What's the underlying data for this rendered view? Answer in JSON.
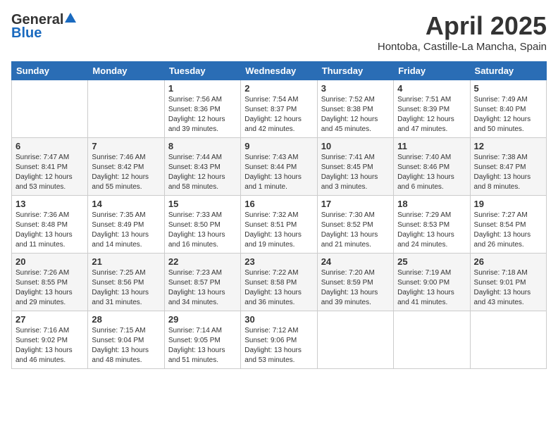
{
  "logo": {
    "general": "General",
    "blue": "Blue"
  },
  "header": {
    "month": "April 2025",
    "location": "Hontoba, Castille-La Mancha, Spain"
  },
  "weekdays": [
    "Sunday",
    "Monday",
    "Tuesday",
    "Wednesday",
    "Thursday",
    "Friday",
    "Saturday"
  ],
  "weeks": [
    [
      {
        "day": "",
        "sunrise": "",
        "sunset": "",
        "daylight": ""
      },
      {
        "day": "",
        "sunrise": "",
        "sunset": "",
        "daylight": ""
      },
      {
        "day": "1",
        "sunrise": "Sunrise: 7:56 AM",
        "sunset": "Sunset: 8:36 PM",
        "daylight": "Daylight: 12 hours and 39 minutes."
      },
      {
        "day": "2",
        "sunrise": "Sunrise: 7:54 AM",
        "sunset": "Sunset: 8:37 PM",
        "daylight": "Daylight: 12 hours and 42 minutes."
      },
      {
        "day": "3",
        "sunrise": "Sunrise: 7:52 AM",
        "sunset": "Sunset: 8:38 PM",
        "daylight": "Daylight: 12 hours and 45 minutes."
      },
      {
        "day": "4",
        "sunrise": "Sunrise: 7:51 AM",
        "sunset": "Sunset: 8:39 PM",
        "daylight": "Daylight: 12 hours and 47 minutes."
      },
      {
        "day": "5",
        "sunrise": "Sunrise: 7:49 AM",
        "sunset": "Sunset: 8:40 PM",
        "daylight": "Daylight: 12 hours and 50 minutes."
      }
    ],
    [
      {
        "day": "6",
        "sunrise": "Sunrise: 7:47 AM",
        "sunset": "Sunset: 8:41 PM",
        "daylight": "Daylight: 12 hours and 53 minutes."
      },
      {
        "day": "7",
        "sunrise": "Sunrise: 7:46 AM",
        "sunset": "Sunset: 8:42 PM",
        "daylight": "Daylight: 12 hours and 55 minutes."
      },
      {
        "day": "8",
        "sunrise": "Sunrise: 7:44 AM",
        "sunset": "Sunset: 8:43 PM",
        "daylight": "Daylight: 12 hours and 58 minutes."
      },
      {
        "day": "9",
        "sunrise": "Sunrise: 7:43 AM",
        "sunset": "Sunset: 8:44 PM",
        "daylight": "Daylight: 13 hours and 1 minute."
      },
      {
        "day": "10",
        "sunrise": "Sunrise: 7:41 AM",
        "sunset": "Sunset: 8:45 PM",
        "daylight": "Daylight: 13 hours and 3 minutes."
      },
      {
        "day": "11",
        "sunrise": "Sunrise: 7:40 AM",
        "sunset": "Sunset: 8:46 PM",
        "daylight": "Daylight: 13 hours and 6 minutes."
      },
      {
        "day": "12",
        "sunrise": "Sunrise: 7:38 AM",
        "sunset": "Sunset: 8:47 PM",
        "daylight": "Daylight: 13 hours and 8 minutes."
      }
    ],
    [
      {
        "day": "13",
        "sunrise": "Sunrise: 7:36 AM",
        "sunset": "Sunset: 8:48 PM",
        "daylight": "Daylight: 13 hours and 11 minutes."
      },
      {
        "day": "14",
        "sunrise": "Sunrise: 7:35 AM",
        "sunset": "Sunset: 8:49 PM",
        "daylight": "Daylight: 13 hours and 14 minutes."
      },
      {
        "day": "15",
        "sunrise": "Sunrise: 7:33 AM",
        "sunset": "Sunset: 8:50 PM",
        "daylight": "Daylight: 13 hours and 16 minutes."
      },
      {
        "day": "16",
        "sunrise": "Sunrise: 7:32 AM",
        "sunset": "Sunset: 8:51 PM",
        "daylight": "Daylight: 13 hours and 19 minutes."
      },
      {
        "day": "17",
        "sunrise": "Sunrise: 7:30 AM",
        "sunset": "Sunset: 8:52 PM",
        "daylight": "Daylight: 13 hours and 21 minutes."
      },
      {
        "day": "18",
        "sunrise": "Sunrise: 7:29 AM",
        "sunset": "Sunset: 8:53 PM",
        "daylight": "Daylight: 13 hours and 24 minutes."
      },
      {
        "day": "19",
        "sunrise": "Sunrise: 7:27 AM",
        "sunset": "Sunset: 8:54 PM",
        "daylight": "Daylight: 13 hours and 26 minutes."
      }
    ],
    [
      {
        "day": "20",
        "sunrise": "Sunrise: 7:26 AM",
        "sunset": "Sunset: 8:55 PM",
        "daylight": "Daylight: 13 hours and 29 minutes."
      },
      {
        "day": "21",
        "sunrise": "Sunrise: 7:25 AM",
        "sunset": "Sunset: 8:56 PM",
        "daylight": "Daylight: 13 hours and 31 minutes."
      },
      {
        "day": "22",
        "sunrise": "Sunrise: 7:23 AM",
        "sunset": "Sunset: 8:57 PM",
        "daylight": "Daylight: 13 hours and 34 minutes."
      },
      {
        "day": "23",
        "sunrise": "Sunrise: 7:22 AM",
        "sunset": "Sunset: 8:58 PM",
        "daylight": "Daylight: 13 hours and 36 minutes."
      },
      {
        "day": "24",
        "sunrise": "Sunrise: 7:20 AM",
        "sunset": "Sunset: 8:59 PM",
        "daylight": "Daylight: 13 hours and 39 minutes."
      },
      {
        "day": "25",
        "sunrise": "Sunrise: 7:19 AM",
        "sunset": "Sunset: 9:00 PM",
        "daylight": "Daylight: 13 hours and 41 minutes."
      },
      {
        "day": "26",
        "sunrise": "Sunrise: 7:18 AM",
        "sunset": "Sunset: 9:01 PM",
        "daylight": "Daylight: 13 hours and 43 minutes."
      }
    ],
    [
      {
        "day": "27",
        "sunrise": "Sunrise: 7:16 AM",
        "sunset": "Sunset: 9:02 PM",
        "daylight": "Daylight: 13 hours and 46 minutes."
      },
      {
        "day": "28",
        "sunrise": "Sunrise: 7:15 AM",
        "sunset": "Sunset: 9:04 PM",
        "daylight": "Daylight: 13 hours and 48 minutes."
      },
      {
        "day": "29",
        "sunrise": "Sunrise: 7:14 AM",
        "sunset": "Sunset: 9:05 PM",
        "daylight": "Daylight: 13 hours and 51 minutes."
      },
      {
        "day": "30",
        "sunrise": "Sunrise: 7:12 AM",
        "sunset": "Sunset: 9:06 PM",
        "daylight": "Daylight: 13 hours and 53 minutes."
      },
      {
        "day": "",
        "sunrise": "",
        "sunset": "",
        "daylight": ""
      },
      {
        "day": "",
        "sunrise": "",
        "sunset": "",
        "daylight": ""
      },
      {
        "day": "",
        "sunrise": "",
        "sunset": "",
        "daylight": ""
      }
    ]
  ]
}
